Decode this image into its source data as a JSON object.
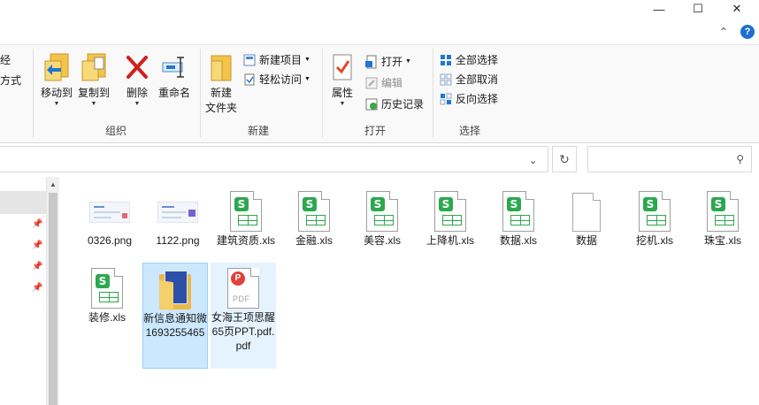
{
  "window": {
    "minimize_icon": "minimize-icon",
    "maximize_icon": "maximize-icon",
    "close_icon": "close-icon",
    "help_label": "?"
  },
  "ribbon": {
    "cut_off_top": "经",
    "cut_off_bottom": "方式",
    "organize": {
      "label": "组织",
      "move_to": "移动到",
      "copy_to": "复制到",
      "delete": "删除",
      "rename": "重命名"
    },
    "new": {
      "label": "新建",
      "new_folder": "新建\n文件夹",
      "new_folder_line1": "新建",
      "new_folder_line2": "文件夹",
      "new_item": "新建项目",
      "easy_access": "轻松访问"
    },
    "open": {
      "label": "打开",
      "properties": "属性",
      "open": "打开",
      "edit": "编辑",
      "history": "历史记录"
    },
    "select": {
      "label": "选择",
      "select_all": "全部选择",
      "select_none": "全部取消",
      "invert": "反向选择"
    }
  },
  "address": {
    "path": "",
    "search_placeholder": ""
  },
  "files": [
    {
      "name": "0326.png",
      "type": "png"
    },
    {
      "name": "1122.png",
      "type": "png"
    },
    {
      "name": "建筑资质.xls",
      "type": "xls"
    },
    {
      "name": "金融.xls",
      "type": "xls"
    },
    {
      "name": "美容.xls",
      "type": "xls"
    },
    {
      "name": "上降机.xls",
      "type": "xls"
    },
    {
      "name": "数据.xls",
      "type": "xls"
    },
    {
      "name": "数据",
      "type": "file"
    },
    {
      "name": "挖机.xls",
      "type": "xls"
    },
    {
      "name": "珠宝.xls",
      "type": "xls"
    },
    {
      "name": "装修.xls",
      "type": "xls"
    },
    {
      "name": "新信息通知微1693255465",
      "type": "folder",
      "selected": true
    },
    {
      "name": "女海王项思醒65页PPT.pdf.pdf",
      "type": "pdf",
      "hover": true
    }
  ],
  "colors": {
    "selection": "#cce8ff",
    "hover": "#e5f3ff",
    "excel_green": "#2ca84f",
    "pdf_red": "#e0413a",
    "accent_blue": "#1e6fd0"
  }
}
